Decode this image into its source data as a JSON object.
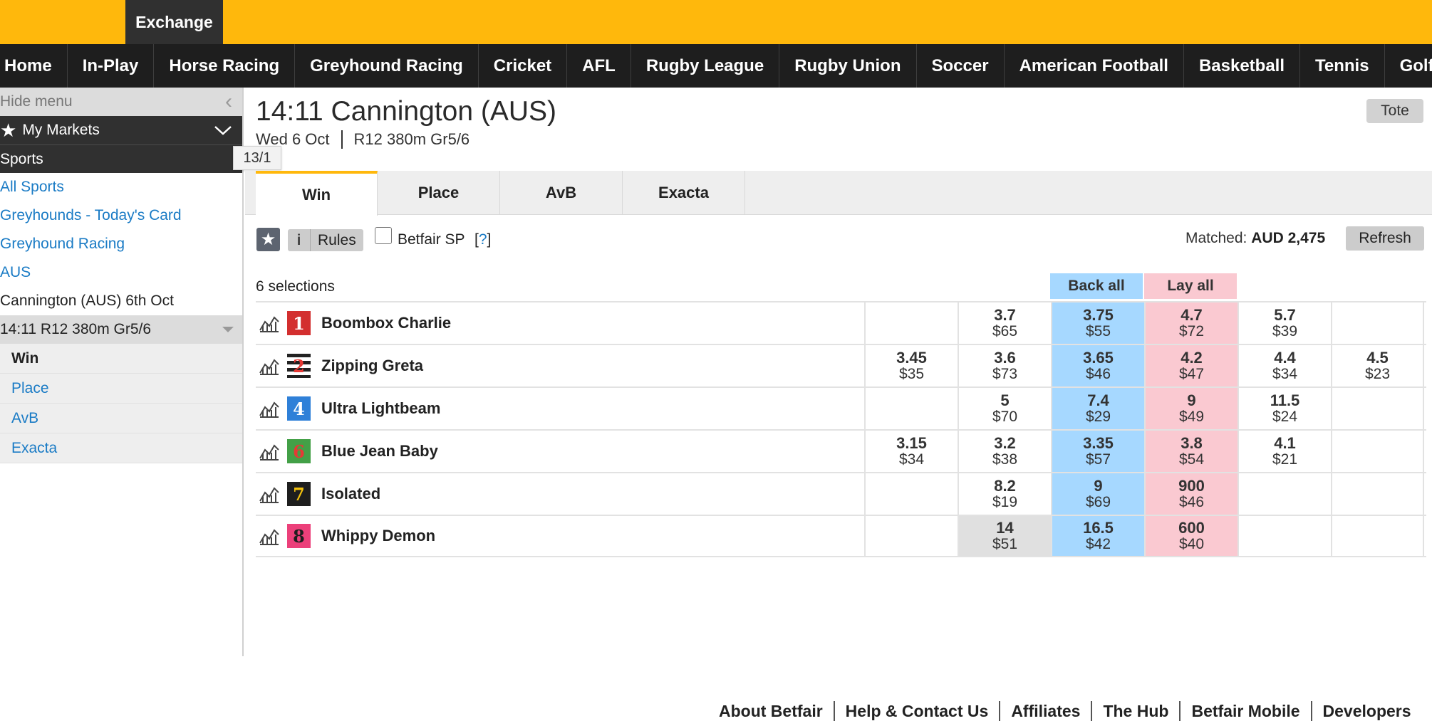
{
  "header": {
    "exchange_label": "Exchange"
  },
  "nav": {
    "items": [
      "Home",
      "In-Play",
      "Horse Racing",
      "Greyhound Racing",
      "Cricket",
      "AFL",
      "Rugby League",
      "Rugby Union",
      "Soccer",
      "American Football",
      "Basketball",
      "Tennis",
      "Golf"
    ]
  },
  "sidebar": {
    "hide_menu": "Hide menu",
    "my_markets": "My Markets",
    "sports": "Sports",
    "links": [
      "All Sports",
      "Greyhounds - Today's Card",
      "Greyhound Racing",
      "AUS"
    ],
    "meeting": "Cannington (AUS) 6th Oct",
    "current_race": "14:11 R12 380m Gr5/6",
    "markets": [
      "Win",
      "Place",
      "AvB",
      "Exacta"
    ]
  },
  "tooltip": "13/1",
  "event": {
    "title": "14:11 Cannington (AUS)",
    "date": "Wed 6 Oct",
    "race": "R12 380m Gr5/6",
    "tote_label": "Tote"
  },
  "tabs": [
    "Win",
    "Place",
    "AvB",
    "Exacta"
  ],
  "toolbar": {
    "info": "i",
    "rules": "Rules",
    "betfair_sp": "Betfair SP",
    "help_open": "[",
    "help_q": "?",
    "help_close": "]",
    "matched_label": "Matched:",
    "matched_value": "AUD 2,475",
    "refresh": "Refresh"
  },
  "market": {
    "selections_count": "6 selections",
    "back_all": "Back all",
    "lay_all": "Lay all",
    "colors": {
      "back": "#a6d8ff",
      "lay": "#fac9d1"
    },
    "runners": [
      {
        "name": "Boombox Charlie",
        "number": "1",
        "silk_bg": "#d32f2f",
        "silk_fg": "#ffffff",
        "back": [
          {
            "price": "",
            "size": ""
          },
          {
            "price": "3.7",
            "size": "$65"
          },
          {
            "price": "3.75",
            "size": "$55"
          }
        ],
        "lay": [
          {
            "price": "4.7",
            "size": "$72"
          },
          {
            "price": "5.7",
            "size": "$39"
          },
          {
            "price": "",
            "size": ""
          }
        ]
      },
      {
        "name": "Zipping Greta",
        "number": "2",
        "silk_bg": "#222222",
        "silk_fg": "#e53935",
        "back": [
          {
            "price": "3.45",
            "size": "$35"
          },
          {
            "price": "3.6",
            "size": "$73"
          },
          {
            "price": "3.65",
            "size": "$46"
          }
        ],
        "lay": [
          {
            "price": "4.2",
            "size": "$47"
          },
          {
            "price": "4.4",
            "size": "$34"
          },
          {
            "price": "4.5",
            "size": "$23"
          }
        ]
      },
      {
        "name": "Ultra Lightbeam",
        "number": "4",
        "silk_bg": "#2f80d8",
        "silk_fg": "#ffffff",
        "back": [
          {
            "price": "",
            "size": ""
          },
          {
            "price": "5",
            "size": "$70"
          },
          {
            "price": "7.4",
            "size": "$29"
          }
        ],
        "lay": [
          {
            "price": "9",
            "size": "$49"
          },
          {
            "price": "11.5",
            "size": "$24"
          },
          {
            "price": "",
            "size": ""
          }
        ]
      },
      {
        "name": "Blue Jean Baby",
        "number": "6",
        "silk_bg": "#43a047",
        "silk_fg": "#e53935",
        "back": [
          {
            "price": "3.15",
            "size": "$34"
          },
          {
            "price": "3.2",
            "size": "$38"
          },
          {
            "price": "3.35",
            "size": "$57"
          }
        ],
        "lay": [
          {
            "price": "3.8",
            "size": "$54"
          },
          {
            "price": "4.1",
            "size": "$21"
          },
          {
            "price": "",
            "size": ""
          }
        ]
      },
      {
        "name": "Isolated",
        "number": "7",
        "silk_bg": "#1e1e1e",
        "silk_fg": "#f4c20d",
        "back": [
          {
            "price": "",
            "size": ""
          },
          {
            "price": "8.2",
            "size": "$19"
          },
          {
            "price": "9",
            "size": "$69"
          }
        ],
        "lay": [
          {
            "price": "900",
            "size": "$46"
          },
          {
            "price": "",
            "size": ""
          },
          {
            "price": "",
            "size": ""
          }
        ]
      },
      {
        "name": "Whippy Demon",
        "number": "8",
        "silk_bg": "#ec407a",
        "silk_fg": "#1e1e1e",
        "back": [
          {
            "price": "",
            "size": ""
          },
          {
            "price": "14",
            "size": "$51"
          },
          {
            "price": "16.5",
            "size": "$42"
          }
        ],
        "lay": [
          {
            "price": "600",
            "size": "$40"
          },
          {
            "price": "",
            "size": ""
          },
          {
            "price": "",
            "size": ""
          }
        ]
      }
    ]
  },
  "footer": [
    "About Betfair",
    "Help & Contact Us",
    "Affiliates",
    "The Hub",
    "Betfair Mobile",
    "Developers"
  ]
}
